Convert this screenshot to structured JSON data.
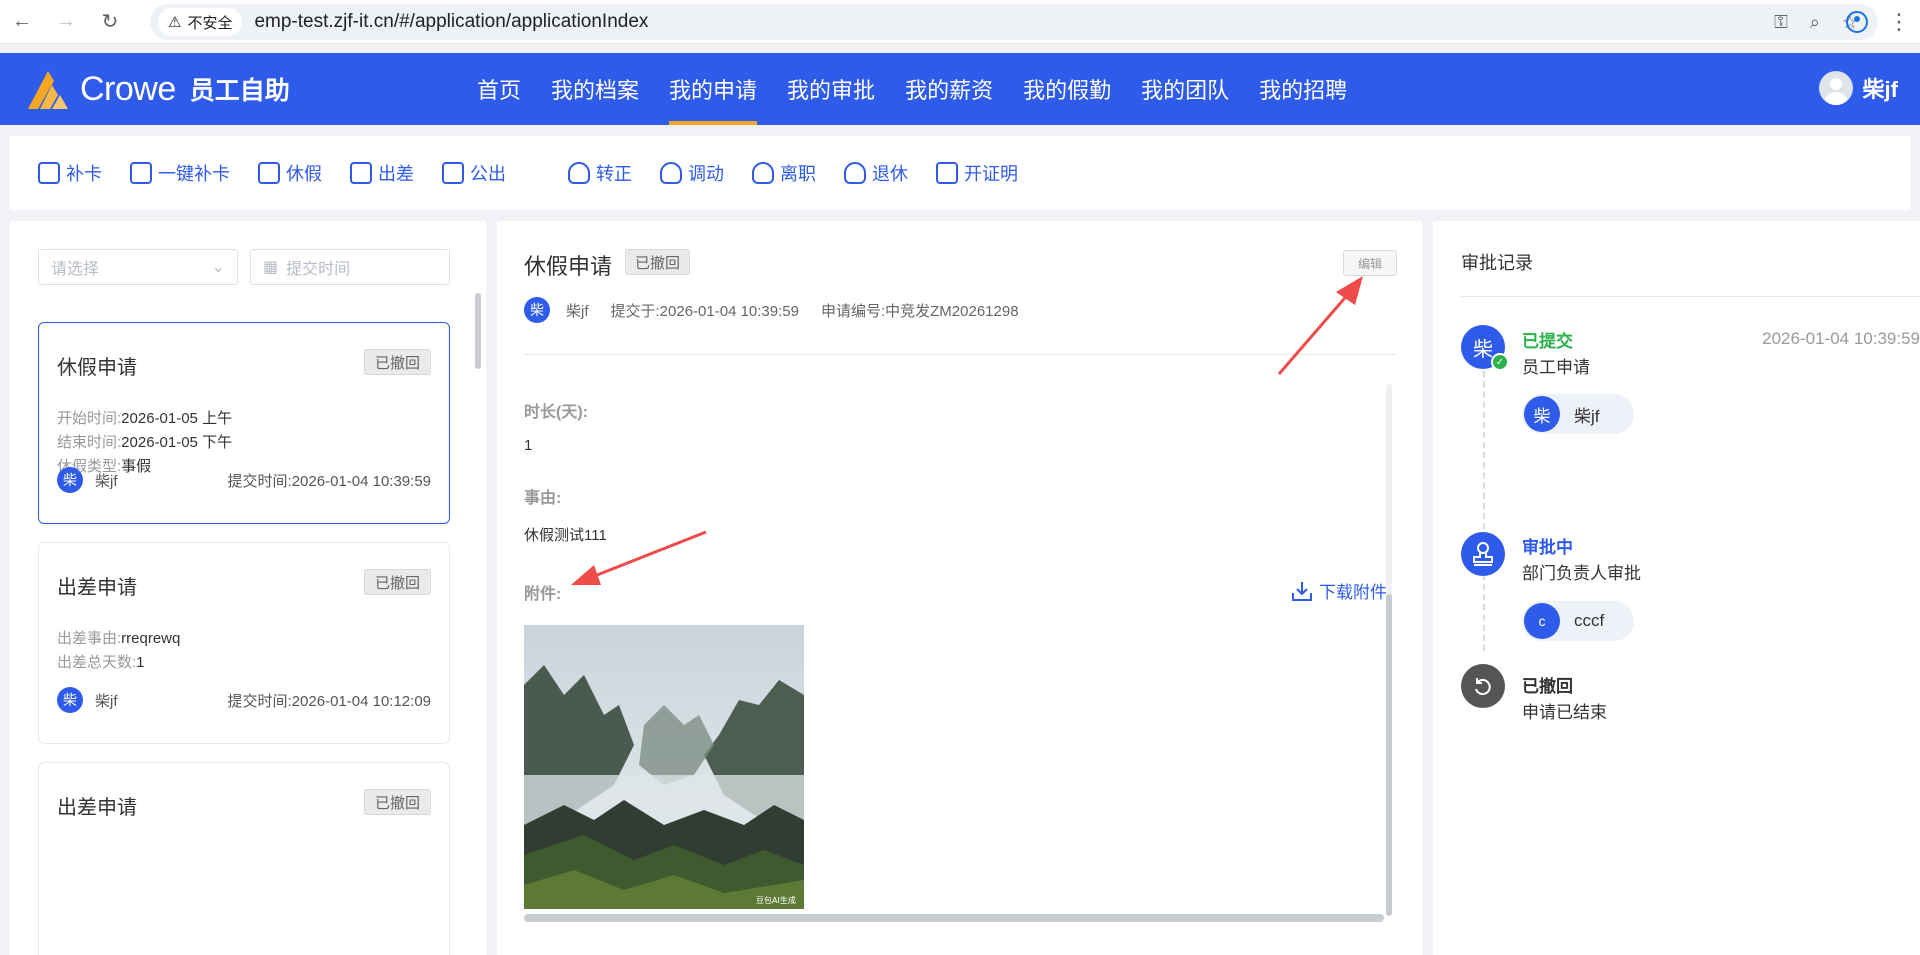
{
  "browser": {
    "insecure_label": "不安全",
    "url": "emp-test.zjf-it.cn/#/application/applicationIndex"
  },
  "header": {
    "brand": "Crowe",
    "subtitle": "员工自助",
    "nav": [
      "首页",
      "我的档案",
      "我的申请",
      "我的审批",
      "我的薪资",
      "我的假勤",
      "我的团队",
      "我的招聘"
    ],
    "active_nav": "我的申请",
    "user_name": "柴jf"
  },
  "actions": {
    "attendance_group": [
      "补卡",
      "一键补卡",
      "休假",
      "出差",
      "公出"
    ],
    "personnel_group": [
      "转正",
      "调动",
      "离职",
      "退休",
      "开证明"
    ]
  },
  "filters": {
    "type_placeholder": "请选择",
    "date_placeholder": "提交时间"
  },
  "list": [
    {
      "title": "休假申请",
      "status": "已撤回",
      "fields": [
        {
          "label": "开始时间:",
          "value": "2026-01-05 上午"
        },
        {
          "label": "结束时间:",
          "value": "2026-01-05 下午"
        },
        {
          "label": "休假类型:",
          "value": "事假"
        }
      ],
      "avatar_char": "柴",
      "applicant": "柴jf",
      "submit_time": "提交时间:2026-01-04 10:39:59"
    },
    {
      "title": "出差申请",
      "status": "已撤回",
      "fields": [
        {
          "label": "出差事由:",
          "value": "rreqrewq"
        },
        {
          "label": "出差总天数:",
          "value": "1"
        }
      ],
      "avatar_char": "柴",
      "applicant": "柴jf",
      "submit_time": "提交时间:2026-01-04 10:12:09"
    },
    {
      "title": "出差申请",
      "status": "已撤回"
    }
  ],
  "detail": {
    "title": "休假申请",
    "status": "已撤回",
    "edit_label": "编辑",
    "avatar_char": "柴",
    "applicant": "柴jf",
    "submitted_at": "提交于:2026-01-04 10:39:59",
    "application_no": "申请编号:中竞发ZM20261298",
    "duration_label": "时长(天):",
    "duration_value": "1",
    "reason_label": "事由:",
    "reason_value": "休假测试111",
    "attachment_label": "附件:",
    "download_label": "下载附件",
    "image_watermark": "豆包AI生成"
  },
  "approval": {
    "title": "审批记录",
    "steps": [
      {
        "status": "已提交",
        "desc": "员工申请",
        "time": "2026-01-04 10:39:59",
        "node_char": "柴",
        "person_char": "柴",
        "person": "柴jf"
      },
      {
        "status": "审批中",
        "desc": "部门负责人审批",
        "person_char": "c",
        "person": "cccf"
      },
      {
        "status": "已撤回",
        "desc": "申请已结束"
      }
    ]
  },
  "colors": {
    "brand_blue": "#2f5bea",
    "accent_orange": "#f5a623",
    "success_green": "#2bb24c",
    "annotation_red": "#ef4b4b"
  }
}
